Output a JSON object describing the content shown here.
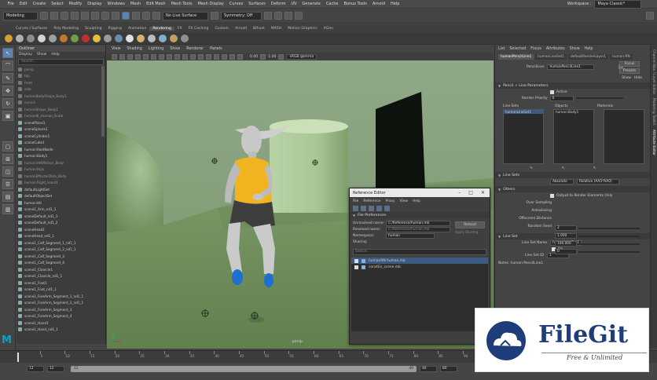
{
  "menubar": {
    "items": [
      "File",
      "Edit",
      "Create",
      "Select",
      "Modify",
      "Display",
      "Windows",
      "Mesh",
      "Edit Mesh",
      "Mesh Tools",
      "Mesh Display",
      "Curves",
      "Surfaces",
      "Deform",
      "UV",
      "Generate",
      "Cache",
      "Bonus Tools",
      "Arnold",
      "Help"
    ],
    "workspace_label": "Workspace :",
    "workspace_value": "Maya Classic*"
  },
  "status": {
    "mode": "Modeling",
    "live_surface": "No Live Surface",
    "symmetry": "Symmetry: Off"
  },
  "shelf_tabs": [
    "Curves / Surfaces",
    "Poly Modeling",
    "Sculpting",
    "Rigging",
    "Animation",
    "Rendering",
    "FX",
    "FX Caching",
    "Custom",
    "Arnold",
    "Bifrost",
    "MASH",
    "Motion Graphics",
    "XGen"
  ],
  "shelf_active": "Rendering",
  "outliner": {
    "title": "Outliner",
    "menus": [
      "Display",
      "Show",
      "Help"
    ],
    "search_placeholder": "Search...",
    "items": [
      {
        "label": "persp",
        "dim": true
      },
      {
        "label": "top",
        "dim": true
      },
      {
        "label": "front",
        "dim": true
      },
      {
        "label": "side",
        "dim": true
      },
      {
        "label": "humanBodyShape_Body1",
        "dim": true
      },
      {
        "label": "curve1",
        "dim": true
      },
      {
        "label": "humanShape_Body1",
        "dim": true
      },
      {
        "label": "humanIK_Human_Scale",
        "dim": true
      },
      {
        "label": "scenePlane1",
        "dim": false
      },
      {
        "label": "sceneSphere1",
        "dim": false
      },
      {
        "label": "sceneCylinder1",
        "dim": false
      },
      {
        "label": "sceneCube1",
        "dim": false
      },
      {
        "label": "human:RootNode",
        "dim": false
      },
      {
        "label": "human:Body1",
        "dim": false
      },
      {
        "label": "human:HIKMotion_Body",
        "dim": true
      },
      {
        "label": "human:Hips",
        "dim": true
      },
      {
        "label": "humanEffectorData_Body",
        "dim": true
      },
      {
        "label": "human:Right_Hand1",
        "dim": true
      },
      {
        "label": "defaultLightSet",
        "dim": false
      },
      {
        "label": "defaultObjectSet",
        "dim": false
      },
      {
        "label": "human:Hit",
        "dim": false
      },
      {
        "label": "scene1_Arm_nd1_1",
        "dim": false
      },
      {
        "label": "sceneDefault_nd1_1",
        "dim": false
      },
      {
        "label": "sceneDefault_nd1_2",
        "dim": false
      },
      {
        "label": "sceneHead1",
        "dim": false
      },
      {
        "label": "sceneHead_nd1_1",
        "dim": false
      },
      {
        "label": "scene1_Calf_Segment_1_nd1_1",
        "dim": false
      },
      {
        "label": "scene1_Calf_Segment_2_nd1_1",
        "dim": false
      },
      {
        "label": "scene1_Calf_Segment_3",
        "dim": false
      },
      {
        "label": "scene1_Calf_Segment_4",
        "dim": false
      },
      {
        "label": "scene1_Clavicle1",
        "dim": false
      },
      {
        "label": "scene1_Clavicle_nd1_1",
        "dim": false
      },
      {
        "label": "scene1_Foot1",
        "dim": false
      },
      {
        "label": "scene1_Foot_nd1_1",
        "dim": false
      },
      {
        "label": "scene1_ForeArm_Segment_1_nd1_1",
        "dim": false
      },
      {
        "label": "scene1_ForeArm_Segment_2_nd1_1",
        "dim": false
      },
      {
        "label": "scene1_ForeArm_Segment_3",
        "dim": false
      },
      {
        "label": "scene1_ForeArm_Segment_4",
        "dim": false
      },
      {
        "label": "scene1_Hand1",
        "dim": false
      },
      {
        "label": "scene1_Hand_nd1_1",
        "dim": false
      }
    ]
  },
  "viewport": {
    "menus": [
      "View",
      "Shading",
      "Lighting",
      "Show",
      "Renderer",
      "Panels"
    ],
    "exposure": "0.00",
    "gamma": "1.00",
    "colorspace": "sRGB gamma",
    "camera_label": "persp"
  },
  "ref_editor": {
    "title": "Reference Editor",
    "menus": [
      "File",
      "Reference",
      "Proxy",
      "View",
      "Help"
    ],
    "file_prefs": "File Preferences",
    "unresolved_label": "Unresolved name:",
    "unresolved_value": "C:/Reference/human.mb",
    "resolved_label": "Resolved name:",
    "resolved_value": "C:/Reference/human.mb",
    "namespace_label": "Namespace:",
    "namespace_value": "human",
    "sharing_label": "Sharing:",
    "reload_label": "Reload",
    "apply_label": "Apply Sharing",
    "search_placeholder": "Search...",
    "rows": [
      "humanRN human.mb",
      "constEx_scene.mb"
    ]
  },
  "attr_editor": {
    "menus": [
      "List",
      "Selected",
      "Focus",
      "Attributes",
      "Show",
      "Help"
    ],
    "tabs": [
      "humanPencilLine1",
      "humanLineSet1",
      "defaultRenderLayer1",
      "human:RN"
    ],
    "node_label": "PencilLine:",
    "node_value": "humanPencilLine1",
    "focus_label": "Focus",
    "presets_label": "Presets",
    "show_label": "Show",
    "hide_label": "Hide",
    "section_params": "Pencil + Line Parameters",
    "active_label": "Active",
    "render_priority_label": "Render Priority",
    "render_priority_value": "0",
    "line_sets_label": "Line Sets",
    "objects_label": "Objects",
    "materials_label": "Materials",
    "line_set_item": "humanLineSet1",
    "object_item": "human:Body1",
    "section_line_sets": "Line Sets",
    "line_dropdown_a": "Absolute",
    "line_dropdown_b": "Relative (AA5*AA0)",
    "section_others": "Others",
    "output_label": "Output to Render Elements Only",
    "over_sampling_label": "Over Sampling",
    "over_sampling_value": "2",
    "antialiasing_label": "Antialiasing",
    "antialiasing_value": "1.000",
    "offscreen_label": "Offscreen Distance",
    "offscreen_value": "100.000",
    "random_seed_label": "Random Seed",
    "random_seed_value": "0",
    "section_line_set": "Line Set",
    "line_set_name_label": "Line Set Name",
    "line_set_name_value": "humanLineSet1",
    "on_label": "On",
    "line_set_id_label": "Line Set ID",
    "line_set_id_value": "1",
    "notes_label": "Notes: human:PencilLine1"
  },
  "side_tabs": [
    "Channel Box / Layer Editor",
    "Modeling Toolkit",
    "Attribute Editor"
  ],
  "timeline": {
    "ticks": [
      "5",
      "10",
      "15",
      "20",
      "25",
      "30",
      "35",
      "40",
      "45",
      "50",
      "55",
      "60",
      "65",
      "70",
      "75",
      "80",
      "85",
      "90",
      "95",
      "100",
      "105",
      "110",
      "115",
      "120"
    ]
  },
  "range": {
    "start": "12",
    "start2": "12",
    "end": "40",
    "end2": "80",
    "current": "12"
  },
  "watermark": {
    "brand": "FileGit",
    "tagline": "Free & Unlimited"
  },
  "colors": {
    "ui_bg": "#444444",
    "ground": "#6d8a5a",
    "shirt": "#f0b020",
    "accent_blue": "#1f6fd1",
    "maya_logo": "#00a6c8"
  }
}
